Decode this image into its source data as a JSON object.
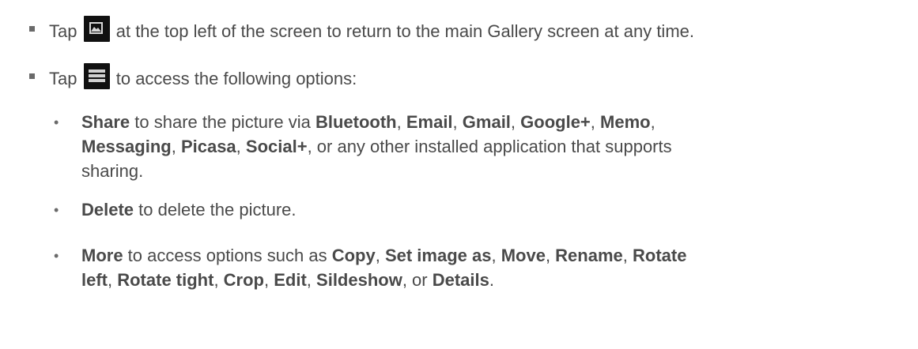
{
  "bullet1": {
    "pre": "Tap",
    "icon": "gallery-icon",
    "post": "at the top left of the screen to return to the main Gallery screen at any time."
  },
  "bullet2": {
    "pre": "Tap",
    "icon": "menu-icon",
    "post": "to access the following options:"
  },
  "share": {
    "term": "Share",
    "t1": " to share the picture via ",
    "bluetooth": "Bluetooth",
    "c1": ", ",
    "email": "Email",
    "c2": ", ",
    "gmail": "Gmail",
    "c3": ", ",
    "googleplus": "Google+",
    "c4": ", ",
    "memo": "Memo",
    "c5": ",",
    "messaging": "Messaging",
    "c6": ", ",
    "picasa": "Picasa",
    "c7": ", ",
    "socialplus": "Social+",
    "t2": ", or any other installed application that supports",
    "t3": "sharing."
  },
  "delete": {
    "term": "Delete",
    "text": " to delete the picture."
  },
  "more": {
    "term": "More",
    "t1": " to access options such as ",
    "copy": "Copy",
    "c1": ", ",
    "setimage": "Set image as",
    "c2": ", ",
    "move": "Move",
    "c3": ", ",
    "rename": "Rename",
    "c4": ", ",
    "rotate": "Rotate",
    "left": "left",
    "c5": ", ",
    "rotatetight": "Rotate tight",
    "c6": ", ",
    "crop": "Crop",
    "c7": ", ",
    "edit": "Edit",
    "c8": ", ",
    "slideshow": "Sildeshow",
    "c9": ", or ",
    "details": "Details",
    "end": "."
  }
}
